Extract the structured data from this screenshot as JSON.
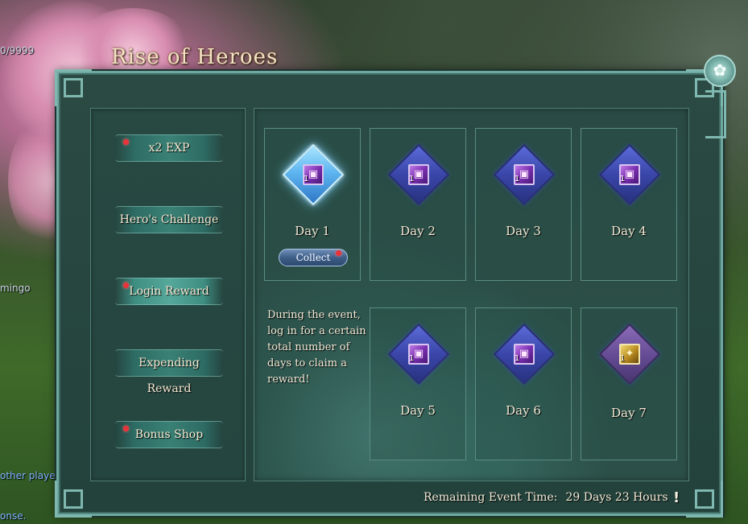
{
  "window": {
    "title": "Rise of Heroes",
    "close_icon": "flower-close-icon"
  },
  "background": {
    "hp_text": "0/9999",
    "npc_name": "mingo",
    "chat_line_1": "other player",
    "chat_line_2": "onse."
  },
  "menu": {
    "items": [
      {
        "label": "x2 EXP",
        "has_notification": true
      },
      {
        "label": "Hero's Challenge",
        "has_notification": false
      },
      {
        "label": "Login Reward",
        "has_notification": true,
        "active": true
      },
      {
        "label": "Expending Reward",
        "has_notification": false
      },
      {
        "label": "Bonus Shop",
        "has_notification": true
      }
    ]
  },
  "rewards": {
    "days": [
      {
        "label": "Day 1",
        "quantity": "1",
        "icon": "purple-card-icon",
        "highlight": true,
        "action": "Collect"
      },
      {
        "label": "Day 2",
        "quantity": "1",
        "icon": "purple-card-icon"
      },
      {
        "label": "Day 3",
        "quantity": "1",
        "icon": "purple-card-icon"
      },
      {
        "label": "Day 4",
        "quantity": "1",
        "icon": "purple-card-icon"
      },
      {
        "label": "Day 5",
        "quantity": "1",
        "icon": "purple-card-icon"
      },
      {
        "label": "Day 6",
        "quantity": "1",
        "icon": "purple-card-icon"
      },
      {
        "label": "Day 7",
        "quantity": "1",
        "icon": "gold-bundle-icon",
        "frame": "purple"
      }
    ],
    "description": "During the event, log in for a certain total number of days to claim a reward!"
  },
  "footer": {
    "remaining_label": "Remaining Event Time:",
    "remaining_value": "29 Days 23 Hours",
    "info_icon_glyph": "!"
  },
  "colors": {
    "panel": "#274640",
    "border": "#6fa8a0",
    "text": "#f3ead6",
    "notification": "#e8333a",
    "title": "#f3e3c5"
  }
}
